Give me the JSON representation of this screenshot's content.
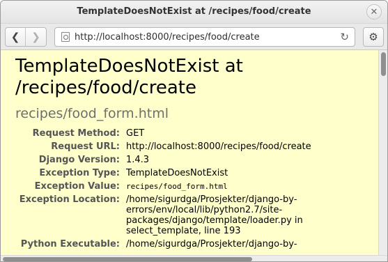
{
  "window": {
    "title": "TemplateDoesNotExist at /recipes/food/create"
  },
  "toolbar": {
    "url": "http://localhost:8000/recipes/food/create"
  },
  "page": {
    "heading": "TemplateDoesNotExist at /recipes/food/create",
    "subheading": "recipes/food_form.html",
    "rows": [
      {
        "label": "Request Method:",
        "value": "GET"
      },
      {
        "label": "Request URL:",
        "value": "http://localhost:8000/recipes/food/create"
      },
      {
        "label": "Django Version:",
        "value": "1.4.3"
      },
      {
        "label": "Exception Type:",
        "value": "TemplateDoesNotExist"
      },
      {
        "label": "Exception Value:",
        "value": "recipes/food_form.html"
      },
      {
        "label": "Exception Location:",
        "value": "/home/sigurdga/Prosjekter/django-by-errors/env/local/lib/python2.7/site-packages/django/template/loader.py in select_template, line 193"
      },
      {
        "label": "Python Executable:",
        "value": "/home/sigurdga/Prosjekter/django-by-"
      }
    ]
  }
}
